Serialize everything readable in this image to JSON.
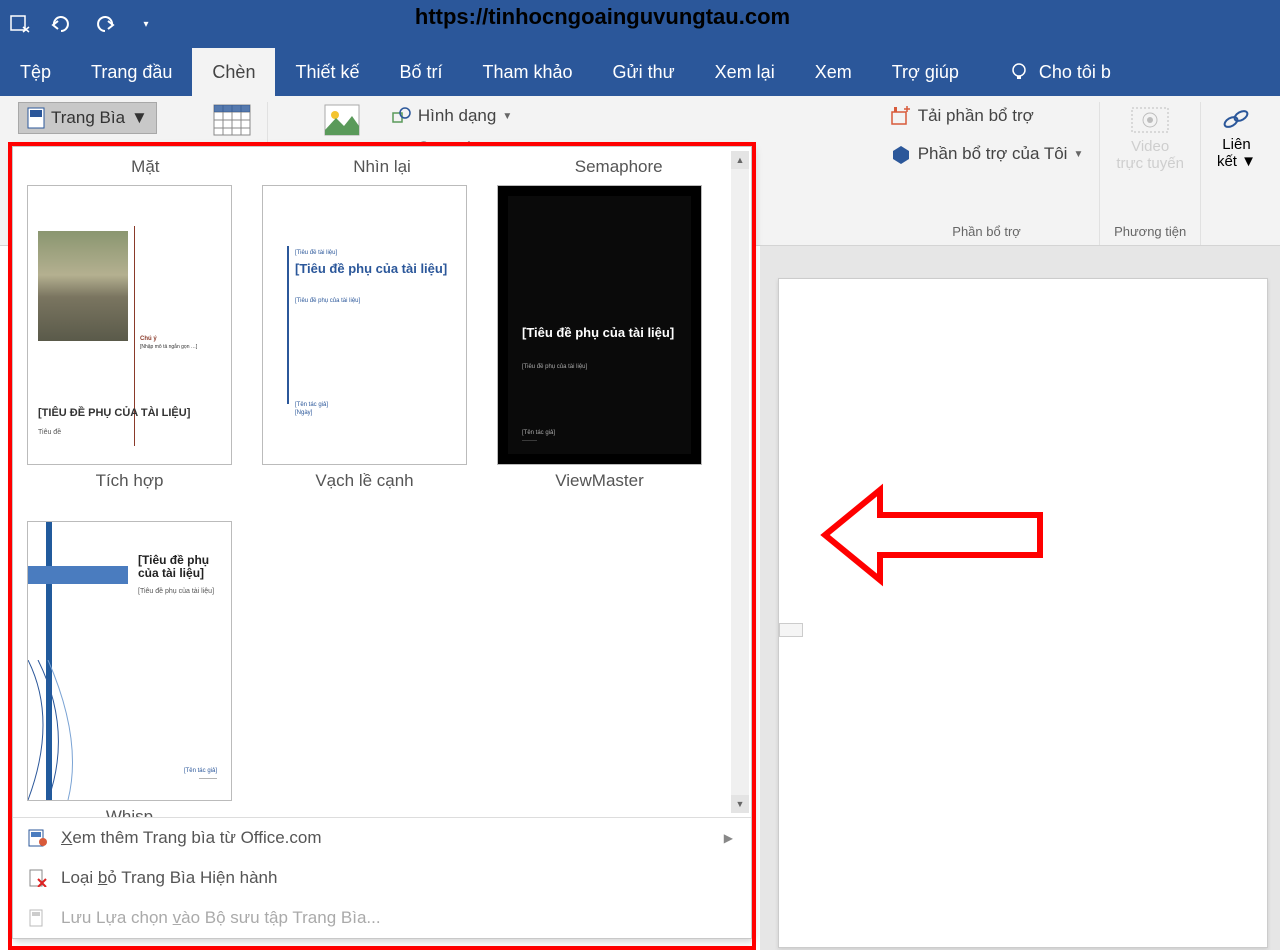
{
  "url_overlay": "https://tinhocngoainguvungtau.com",
  "tabs": {
    "file": "Tệp",
    "home": "Trang đầu",
    "insert": "Chèn",
    "design": "Thiết kế",
    "layout": "Bố trí",
    "references": "Tham khảo",
    "mailings": "Gửi thư",
    "review": "Xem lại",
    "view": "Xem",
    "help": "Trợ giúp",
    "tellme": "Cho tôi b"
  },
  "ribbon": {
    "cover_page": "Trang Bìa",
    "shapes": "Hình dạng",
    "smartart": "SmartArt",
    "get_addins": "Tải phần bổ trợ",
    "my_addins": "Phần bổ trợ của Tôi",
    "addins_group": "Phần bổ trợ",
    "online_video_l1": "Video",
    "online_video_l2": "trực tuyến",
    "media_group": "Phương tiện",
    "links_l1": "Liên",
    "links_l2": "kết"
  },
  "gallery": {
    "headers": {
      "h1": "Mặt",
      "h2": "Nhìn lại",
      "h3": "Semaphore"
    },
    "items": {
      "tichhop": {
        "label": "Tích hợp",
        "cap": "[TIÊU ĐỀ PHỤ CỦA TÀI LIỆU]",
        "small": "Tiêu đề",
        "tiny_a": "Chú ý",
        "tiny_b": "[Nhập mô tả ngắn gọn …]"
      },
      "vach": {
        "label": "Vạch lề cạnh",
        "title": "[Tiêu đề phụ của tài liệu]",
        "sub": "[Tiêu đề phụ của tài liệu]",
        "author": "[Tên tác giả]",
        "date": "[Ngày]"
      },
      "viewmaster": {
        "label": "ViewMaster",
        "title": "[Tiêu đề phụ của tài liệu]",
        "sub": "[Tiêu đề phụ của tài liệu]",
        "author": "[Tên tác giả]"
      },
      "whisp": {
        "label": "Whisp",
        "title": "[Tiêu đề phụ của tài liệu]",
        "sub": "[Tiêu đề phụ của tài liệu]",
        "author": "[Tên tác giả]"
      }
    },
    "footer": {
      "more_pre": "X",
      "more_post": "em thêm Trang bìa từ Office.com",
      "remove_pre": "Loại ",
      "remove_u": "b",
      "remove_post": "ỏ Trang Bìa Hiện hành",
      "save_pre": "Lưu Lựa chọn ",
      "save_u": "v",
      "save_post": "ào Bộ sưu tập Trang Bìa..."
    }
  }
}
